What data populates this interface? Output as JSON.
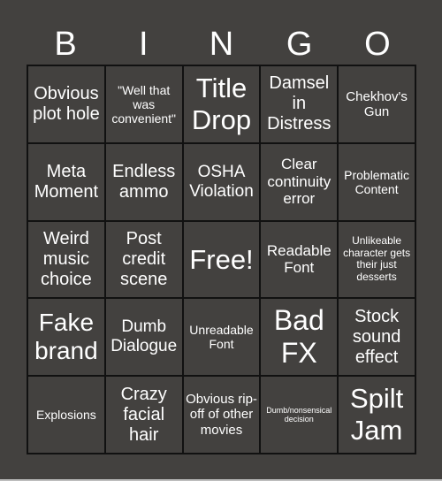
{
  "header": [
    "B",
    "I",
    "N",
    "G",
    "O"
  ],
  "cells": [
    {
      "text": "Obvious plot hole",
      "size": 20
    },
    {
      "text": "\"Well that was convenient\"",
      "size": 14
    },
    {
      "text": "Title Drop",
      "size": 31
    },
    {
      "text": "Damsel in Distress",
      "size": 20
    },
    {
      "text": "Chekhov's Gun",
      "size": 15
    },
    {
      "text": "Meta Moment",
      "size": 20
    },
    {
      "text": "Endless ammo",
      "size": 20
    },
    {
      "text": "OSHA Violation",
      "size": 19
    },
    {
      "text": "Clear continuity error",
      "size": 17
    },
    {
      "text": "Problematic Content",
      "size": 14
    },
    {
      "text": "Weird music choice",
      "size": 20
    },
    {
      "text": "Post credit scene",
      "size": 20
    },
    {
      "text": "Free!",
      "size": 31
    },
    {
      "text": "Readable Font",
      "size": 17
    },
    {
      "text": "Unlikeable character gets their just desserts",
      "size": 12
    },
    {
      "text": "Fake brand",
      "size": 28
    },
    {
      "text": "Dumb Dialogue",
      "size": 19
    },
    {
      "text": "Unreadable Font",
      "size": 14
    },
    {
      "text": "Bad FX",
      "size": 32
    },
    {
      "text": "Stock sound effect",
      "size": 20
    },
    {
      "text": "Explosions",
      "size": 14
    },
    {
      "text": "Crazy facial hair",
      "size": 20
    },
    {
      "text": "Obvious rip-off of other movies",
      "size": 15
    },
    {
      "text": "Dumb/nonsensical decision",
      "size": 9
    },
    {
      "text": "Spilt Jam",
      "size": 31
    }
  ]
}
